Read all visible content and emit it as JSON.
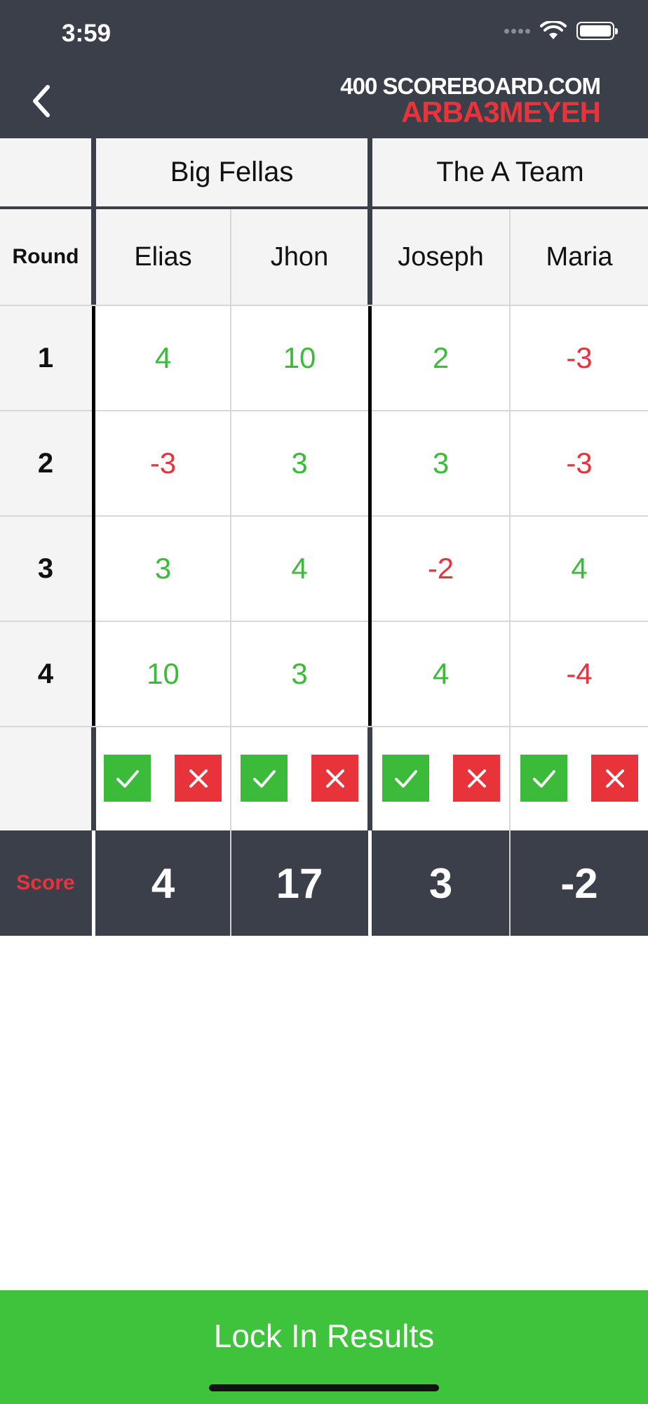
{
  "status_bar": {
    "time": "3:59"
  },
  "header": {
    "brand_top": "400 SCOREBOARD.COM",
    "brand_bottom": "ARBA3MEYEH"
  },
  "teams": [
    {
      "name": "Big Fellas"
    },
    {
      "name": "The A Team"
    }
  ],
  "columns": {
    "round_label": "Round"
  },
  "players": [
    {
      "name": "Elias"
    },
    {
      "name": "Jhon"
    },
    {
      "name": "Joseph"
    },
    {
      "name": "Maria"
    }
  ],
  "rounds": [
    {
      "number": "1",
      "scores": [
        "4",
        "10",
        "2",
        "-3"
      ]
    },
    {
      "number": "2",
      "scores": [
        "-3",
        "3",
        "3",
        "-3"
      ]
    },
    {
      "number": "3",
      "scores": [
        "3",
        "4",
        "-2",
        "4"
      ]
    },
    {
      "number": "4",
      "scores": [
        "10",
        "3",
        "4",
        "-4"
      ]
    }
  ],
  "totals": {
    "label": "Score",
    "values": [
      "4",
      "17",
      "3",
      "-2"
    ]
  },
  "footer": {
    "lock_button": "Lock In Results"
  },
  "colors": {
    "positive": "#3cbb3a",
    "negative": "#e8333a",
    "header_bg": "#3b3f4a",
    "button_bg": "#3fc23c"
  },
  "icons": [
    "chevron-left-icon",
    "wifi-icon",
    "battery-icon",
    "signal-icon",
    "check-icon",
    "close-icon"
  ]
}
